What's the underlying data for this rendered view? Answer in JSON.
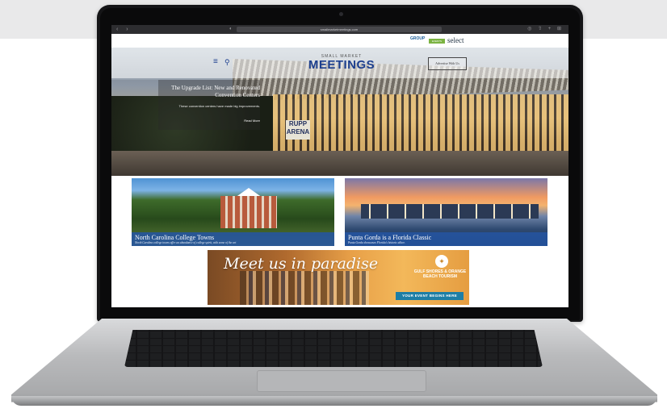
{
  "browser": {
    "nav_arrows": "‹ ›",
    "shield_icon": "◐",
    "url": "smallmarketmeetings.com",
    "icons": "◎ ⇧ + ⊞"
  },
  "topstrip": {
    "group_logo": "GROUP",
    "green_logo": "EVENTS",
    "select_logo": "select"
  },
  "header": {
    "brand_small": "SMALL MARKET",
    "brand_big": "MEETINGS",
    "menu_icon": "≡",
    "search_icon": "⚲",
    "advertise_label": "Advertise With Us"
  },
  "feature": {
    "title": "The Upgrade List: New and Renovated Convention Centers",
    "desc": "These convention centers have made big improvements.",
    "link": "Read More",
    "sign": "RUPP ARENA"
  },
  "cards": [
    {
      "title": "North Carolina College Towns",
      "subtitle": "North Carolina college towns offer an abundance of college spirit, with some of the art"
    },
    {
      "title": "Punta Gorda is a Florida Classic",
      "subtitle": "Punta Gorda showcases Florida's historic allure."
    }
  ],
  "ad": {
    "headline": "Meet us in paradise",
    "org": "GULF SHORES & ORANGE BEACH TOURISM",
    "cta": "YOUR EVENT BEGINS HERE",
    "logo_icon": "✦"
  }
}
